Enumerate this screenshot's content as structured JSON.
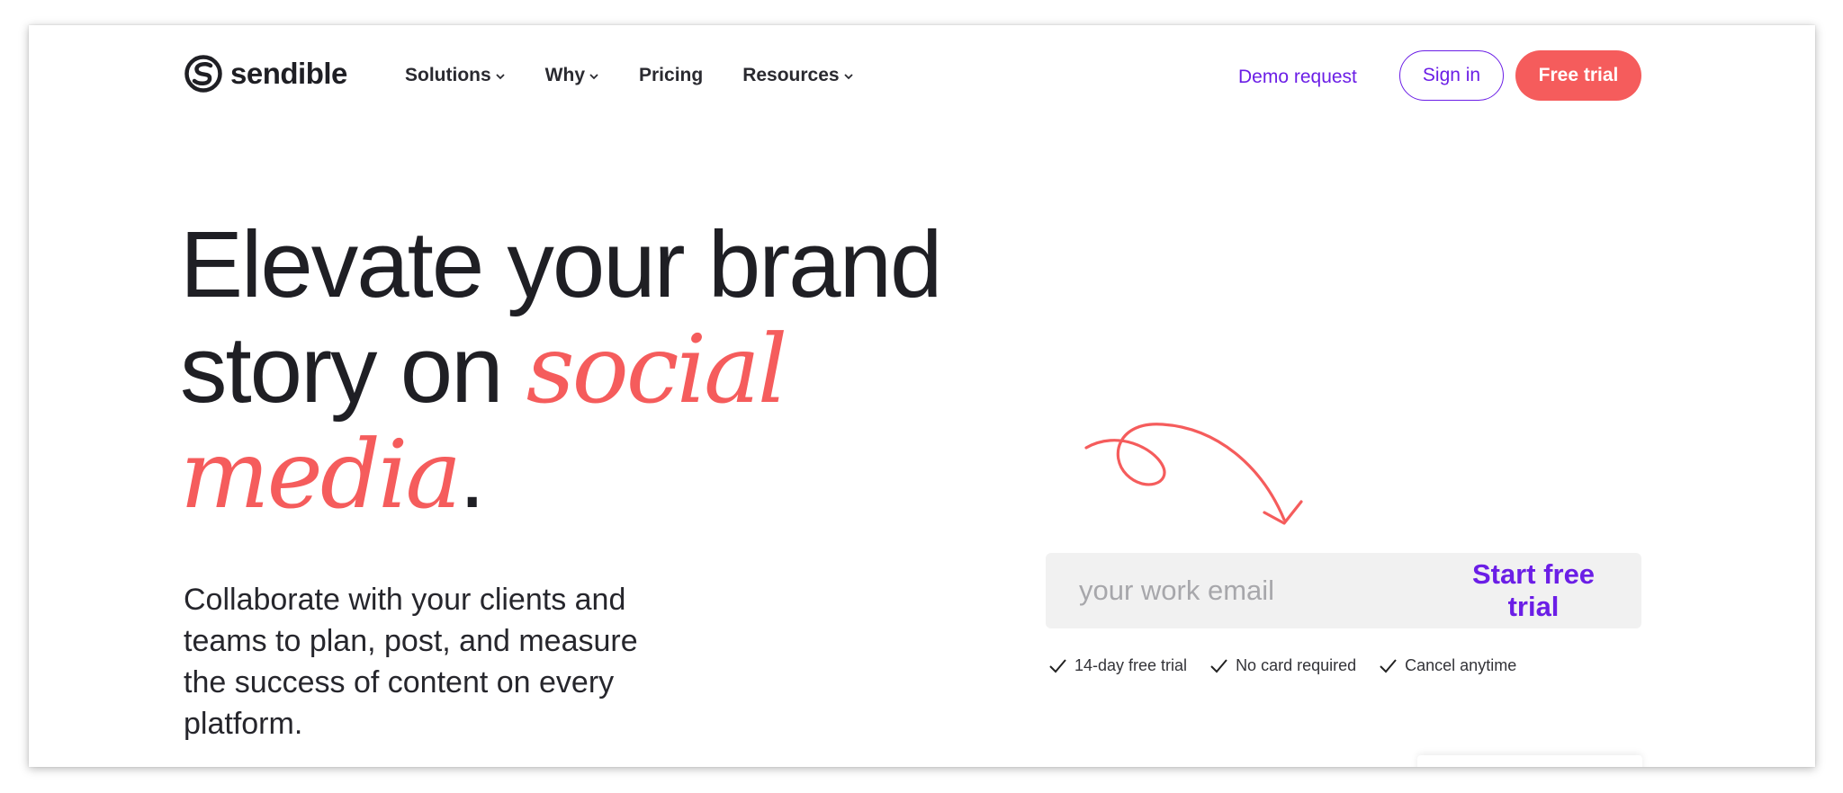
{
  "brand": {
    "name": "sendible",
    "accent_color": "#f55c5c",
    "link_color": "#6b1ee6"
  },
  "nav": {
    "items": [
      {
        "label": "Solutions",
        "has_dropdown": true
      },
      {
        "label": "Why",
        "has_dropdown": true
      },
      {
        "label": "Pricing",
        "has_dropdown": false
      },
      {
        "label": "Resources",
        "has_dropdown": true
      }
    ],
    "demo_label": "Demo request",
    "signin_label": "Sign in",
    "trial_label": "Free trial"
  },
  "hero": {
    "headline_part1": "Elevate your brand story on",
    "headline_accent1": "social",
    "headline_accent2": "media",
    "headline_end": ".",
    "subcopy": "Collaborate with your clients and teams to plan, post, and measure the success of content on every platform."
  },
  "signup": {
    "email_placeholder": "your work email",
    "cta_label": "Start free trial",
    "perks": [
      "14-day free trial",
      "No card required",
      "Cancel anytime"
    ]
  },
  "icons": {
    "logo": "sendible-logo-icon",
    "dropdown": "chevron-down-icon",
    "check": "check-icon",
    "arrow": "curly-arrow-icon"
  }
}
